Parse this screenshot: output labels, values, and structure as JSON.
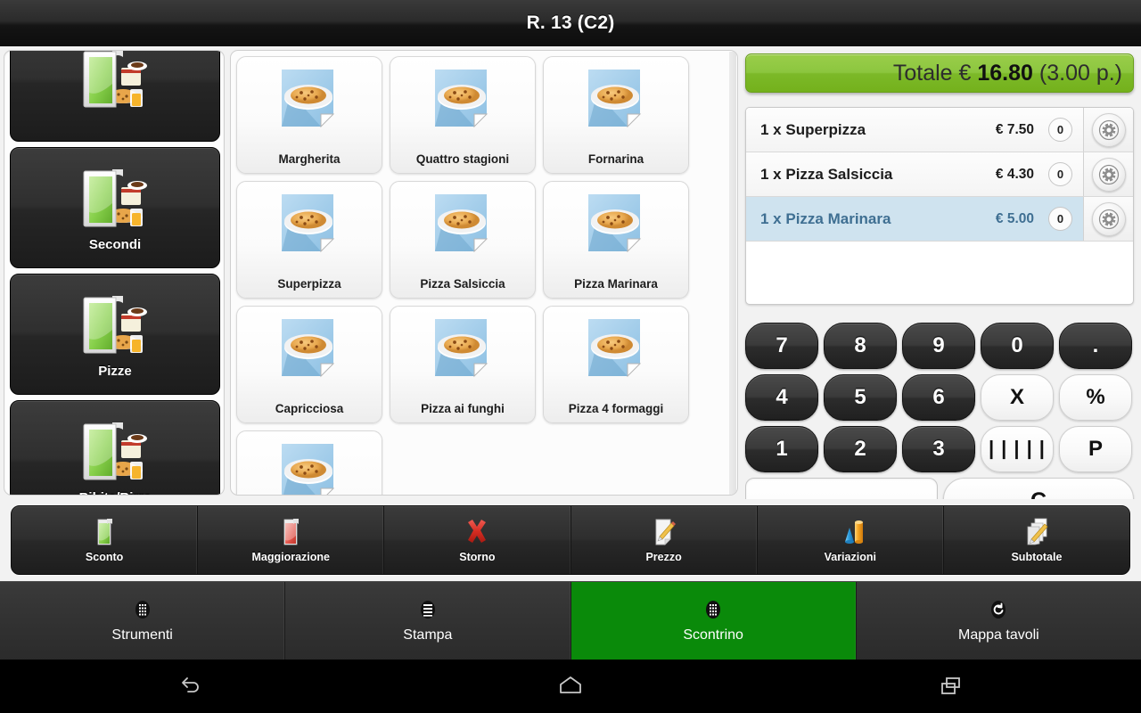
{
  "window": {
    "title": "R. 13 (C2)"
  },
  "sidebar": {
    "categories": [
      {
        "label": "",
        "icon": "folder-menu-icon",
        "partial": true
      },
      {
        "label": "Secondi",
        "icon": "folder-menu-icon"
      },
      {
        "label": "Pizze",
        "icon": "folder-menu-icon"
      },
      {
        "label": "Bibite/Birre",
        "icon": "folder-menu-icon"
      },
      {
        "label": "",
        "icon": "folder-menu-icon",
        "partial": true
      }
    ]
  },
  "products": {
    "items": [
      {
        "label": "Margherita",
        "icon": "dish-icon"
      },
      {
        "label": "Quattro stagioni",
        "icon": "dish-icon"
      },
      {
        "label": "Fornarina",
        "icon": "dish-icon"
      },
      {
        "label": "Superpizza",
        "icon": "dish-icon"
      },
      {
        "label": "Pizza Salsiccia",
        "icon": "dish-icon"
      },
      {
        "label": "Pizza Marinara",
        "icon": "dish-icon"
      },
      {
        "label": "Capricciosa",
        "icon": "dish-icon"
      },
      {
        "label": "Pizza ai funghi",
        "icon": "dish-icon"
      },
      {
        "label": "Pizza 4 formaggi",
        "icon": "dish-icon"
      },
      {
        "label": "",
        "icon": "dish-icon"
      }
    ]
  },
  "receipt": {
    "total_label": "Totale €",
    "total_amount": "16.80",
    "total_persons": "(3.00 p.)",
    "total_text": "Totale € 16.80 (3.00 p.)",
    "accent_color": "#8cc63f",
    "selected_row_bg": "#cfe3ef",
    "selected_row_fg": "#3f6f92",
    "lines": [
      {
        "name": "1 x Superpizza",
        "price": "€ 7.50",
        "qty": "0",
        "selected": false,
        "gear": "gear-icon"
      },
      {
        "name": "1 x Pizza Salsiccia",
        "price": "€ 4.30",
        "qty": "0",
        "selected": false,
        "gear": "gear-icon"
      },
      {
        "name": "1 x Pizza Marinara",
        "price": "€ 5.00",
        "qty": "0",
        "selected": true,
        "gear": "gear-icon"
      }
    ]
  },
  "keypad": {
    "display_value": "",
    "rows": [
      [
        {
          "label": "7",
          "style": "dark"
        },
        {
          "label": "8",
          "style": "dark"
        },
        {
          "label": "9",
          "style": "dark"
        },
        {
          "label": "0",
          "style": "dark"
        },
        {
          "label": ".",
          "style": "dark"
        }
      ],
      [
        {
          "label": "4",
          "style": "dark"
        },
        {
          "label": "5",
          "style": "dark"
        },
        {
          "label": "6",
          "style": "dark"
        },
        {
          "label": "X",
          "style": "light"
        },
        {
          "label": "%",
          "style": "light"
        }
      ],
      [
        {
          "label": "1",
          "style": "dark"
        },
        {
          "label": "2",
          "style": "dark"
        },
        {
          "label": "3",
          "style": "dark"
        },
        {
          "label": "|||||",
          "style": "light"
        },
        {
          "label": "P",
          "style": "light"
        }
      ]
    ],
    "clear_label": "C"
  },
  "actions": [
    {
      "label": "Sconto",
      "icon": "green-card-icon"
    },
    {
      "label": "Maggiorazione",
      "icon": "red-card-icon"
    },
    {
      "label": "Storno",
      "icon": "red-x-icon"
    },
    {
      "label": "Prezzo",
      "icon": "document-pencil-icon"
    },
    {
      "label": "Variazioni",
      "icon": "chart-shapes-icon"
    },
    {
      "label": "Subtotale",
      "icon": "documents-pencil-icon"
    }
  ],
  "nav": {
    "active_color": "#0a8a0a",
    "items": [
      {
        "label": "Strumenti",
        "icon": "grid-icon",
        "active": false
      },
      {
        "label": "Stampa",
        "icon": "list-icon",
        "active": false
      },
      {
        "label": "Scontrino",
        "icon": "grid-icon",
        "active": true
      },
      {
        "label": "Mappa tavoli",
        "icon": "refresh-icon",
        "active": false
      }
    ]
  },
  "system_bar": {
    "buttons": [
      {
        "icon": "back-icon"
      },
      {
        "icon": "home-icon"
      },
      {
        "icon": "recents-icon"
      }
    ]
  }
}
